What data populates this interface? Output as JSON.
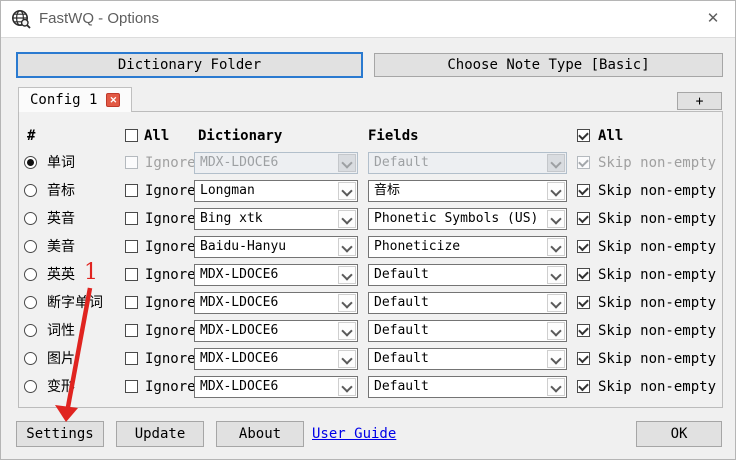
{
  "titlebar": {
    "title": "FastWQ - Options",
    "close_glyph": "✕",
    "app_icon": "globe-search-icon"
  },
  "top_buttons": {
    "dictionary_folder": "Dictionary Folder",
    "choose_note_type": "Choose Note Type [Basic]"
  },
  "tabs": {
    "active_label": "Config 1",
    "close_glyph": "✕",
    "add_label": "+"
  },
  "table": {
    "headers": {
      "hash": "#",
      "all_left": "All",
      "dictionary": "Dictionary",
      "fields": "Fields",
      "all_right": "All"
    },
    "ignore_label": "Ignore",
    "skip_label": "Skip non-empty",
    "rows": [
      {
        "label": "单词",
        "dictionary": "MDX-LDOCE6",
        "field": "Default",
        "selected": true,
        "disabled": true
      },
      {
        "label": "音标",
        "dictionary": "Longman",
        "field": "音标",
        "selected": false,
        "disabled": false
      },
      {
        "label": "英音",
        "dictionary": "Bing xtk",
        "field": "Phonetic Symbols (US)",
        "selected": false,
        "disabled": false
      },
      {
        "label": "美音",
        "dictionary": "Baidu-Hanyu",
        "field": "Phoneticize",
        "selected": false,
        "disabled": false
      },
      {
        "label": "英英",
        "dictionary": "MDX-LDOCE6",
        "field": "Default",
        "selected": false,
        "disabled": false
      },
      {
        "label": "断字单词",
        "dictionary": "MDX-LDOCE6",
        "field": "Default",
        "selected": false,
        "disabled": false
      },
      {
        "label": "词性",
        "dictionary": "MDX-LDOCE6",
        "field": "Default",
        "selected": false,
        "disabled": false
      },
      {
        "label": "图片",
        "dictionary": "MDX-LDOCE6",
        "field": "Default",
        "selected": false,
        "disabled": false
      },
      {
        "label": "变形",
        "dictionary": "MDX-LDOCE6",
        "field": "Default",
        "selected": false,
        "disabled": false
      }
    ]
  },
  "footer": {
    "settings": "Settings",
    "update": "Update",
    "about": "About",
    "user_guide": "User Guide",
    "ok": "OK"
  },
  "annotations": {
    "step_number": "1",
    "annotation_color": "#e02420"
  },
  "colors": {
    "window_bg": "#f0f0f0",
    "titlebar_bg": "#ffffff",
    "button_bg": "#e1e1e1",
    "focus_border": "#2a7ad0",
    "tab_close_bg": "#e25944",
    "link": "#0000e8"
  }
}
